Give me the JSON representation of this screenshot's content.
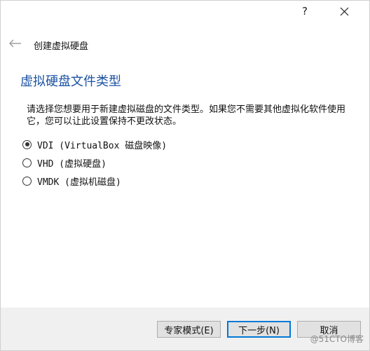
{
  "titlebar": {
    "help_label": "?",
    "help_icon": "question-mark-icon",
    "close_icon": "close-icon"
  },
  "header": {
    "back_icon": "back-arrow-icon",
    "wizard_title": "创建虚拟硬盘"
  },
  "page": {
    "title": "虚拟硬盘文件类型",
    "description": "请选择您想要用于新建虚拟磁盘的文件类型。如果您不需要其他虚拟化软件使用它，您可以让此设置保持不更改状态。"
  },
  "options": [
    {
      "label": "VDI (VirtualBox 磁盘映像)",
      "checked": true
    },
    {
      "label": "VHD (虚拟硬盘)",
      "checked": false
    },
    {
      "label": "VMDK (虚拟机磁盘)",
      "checked": false
    }
  ],
  "buttons": {
    "expert": "专家模式(E)",
    "next": "下一步(N)",
    "cancel": "取消"
  },
  "watermark": "@51CTO博客",
  "colors": {
    "page_title": "#1c52a3",
    "default_button_border": "#0078d7",
    "footer_bg": "#f0f0f0"
  }
}
